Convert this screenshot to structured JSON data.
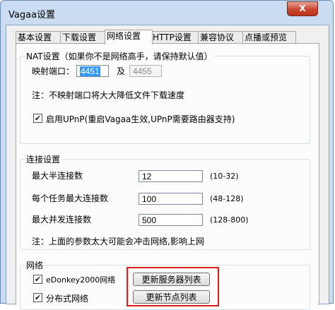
{
  "window": {
    "title": "Vagaa设置",
    "close_label": "X"
  },
  "tabs": [
    {
      "label": "基本设置"
    },
    {
      "label": "下载设置"
    },
    {
      "label": "网络设置"
    },
    {
      "label": "HTTP设置"
    },
    {
      "label": "兼容协议"
    },
    {
      "label": "点播或预览"
    }
  ],
  "active_tab": "网络设置",
  "nat": {
    "legend": "NAT设置（如果你不是网络高手，请保持默认值）",
    "port_label": "映射端口：",
    "port_value": "4451",
    "and_label": "及",
    "port2_value": "4455",
    "note": "注：不映射端口将大大降低文件下载速度",
    "upnp_label": "启用UPnP(重启Vagaa生效,UPnP需要路由器支持)",
    "upnp_checked": true
  },
  "connection": {
    "legend": "连接设置",
    "rows": [
      {
        "label": "最大半连接数",
        "value": "12",
        "range": "(10-32)"
      },
      {
        "label": "每个任务最大连接数",
        "value": "100",
        "range": "(48-128)"
      },
      {
        "label": "最大并发连接数",
        "value": "500",
        "range": "(128-800)"
      }
    ],
    "note": "注：上面的参数太大可能会冲击网络,影响上网"
  },
  "network": {
    "legend": "网络",
    "edonkey_label": "eDonkey2000网络",
    "edonkey_checked": true,
    "dht_label": "分布式网络",
    "dht_checked": true,
    "update_server_button": "更新服务器列表",
    "update_node_button": "更新节点列表"
  },
  "colors": {
    "highlight": "#e01b1b",
    "selection": "#3399ff"
  }
}
